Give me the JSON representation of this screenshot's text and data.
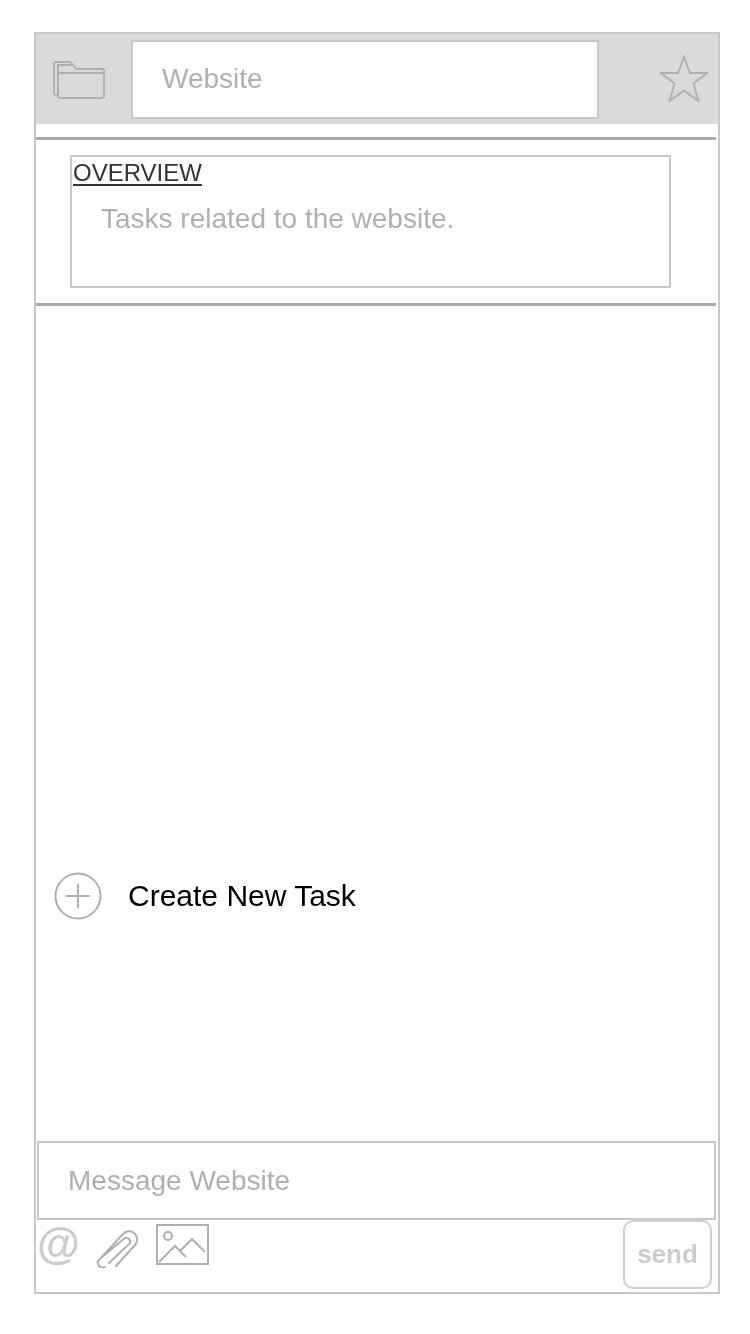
{
  "header": {
    "title_field": {
      "value": "Website"
    },
    "favorite": false
  },
  "overview": {
    "heading": "OVERVIEW",
    "text": "Tasks related to the website."
  },
  "tasks": {
    "create_label": "Create New Task"
  },
  "composer": {
    "placeholder": "Message Website",
    "mention_label": "@",
    "send_label": "send"
  }
}
